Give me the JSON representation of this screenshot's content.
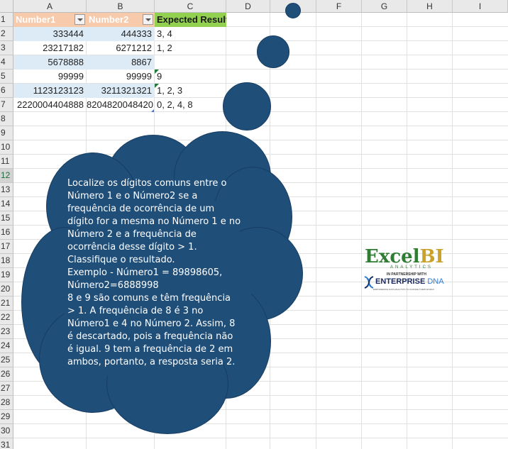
{
  "columns": [
    "A",
    "B",
    "C",
    "D",
    "E",
    "F",
    "G",
    "H",
    "I"
  ],
  "rows": [
    "1",
    "2",
    "3",
    "4",
    "5",
    "6",
    "7",
    "8",
    "9",
    "10",
    "11",
    "12",
    "13",
    "14",
    "15",
    "16",
    "17",
    "18",
    "19",
    "20",
    "21",
    "22",
    "23",
    "24",
    "25",
    "26",
    "27",
    "28",
    "29",
    "30",
    "31"
  ],
  "table": {
    "headers": [
      "Number1",
      "Number2",
      "Expected Result"
    ],
    "data": [
      [
        "333444",
        "444333",
        "3, 4"
      ],
      [
        "23217182",
        "6271212",
        "1, 2"
      ],
      [
        "5678888",
        "8867",
        ""
      ],
      [
        "99999",
        "99999",
        "9"
      ],
      [
        "1123123123",
        "3211321321",
        "1, 2, 3"
      ],
      [
        "2220004404888",
        "8204820048420",
        "0, 2, 4, 8"
      ]
    ]
  },
  "callout": {
    "text": "Localize os dígitos comuns entre o Número 1 e o Número2 se a frequência de ocorrência de um dígito for a mesma no Número 1 e no Número 2 e a frequência de ocorrência desse dígito > 1. Classifique o resultado.\nExemplo - Número1 = 89898605, Número2=6888998\n8 e 9 são comuns e têm frequência > 1. A frequência de 8 é 3 no Número1 e 4 no Número 2. Assim, 8 é descartado, pois a frequência não é igual. 9 tem a frequência de 2 em ambos, portanto, a resposta seria 2."
  },
  "logo": {
    "excel": "Excel",
    "bi": "BI",
    "analytics": "ANALYTICS",
    "partnership": "IN PARTNERSHIP WITH",
    "enterprise": "ENTERPRISE",
    "dna": "DNA",
    "tagline": "EMPOWERING DATA ANALYSTS TO CHANGE THEIR WORLD",
    "colors": {
      "green": "#2e7d32",
      "gold": "#c9a227",
      "navy": "#1b2a5e",
      "blue": "#2b7bd3"
    }
  },
  "colors": {
    "callout": "#1f4e79",
    "header": "#f7caac",
    "expected": "#92d050",
    "band": "#ddebf7"
  }
}
